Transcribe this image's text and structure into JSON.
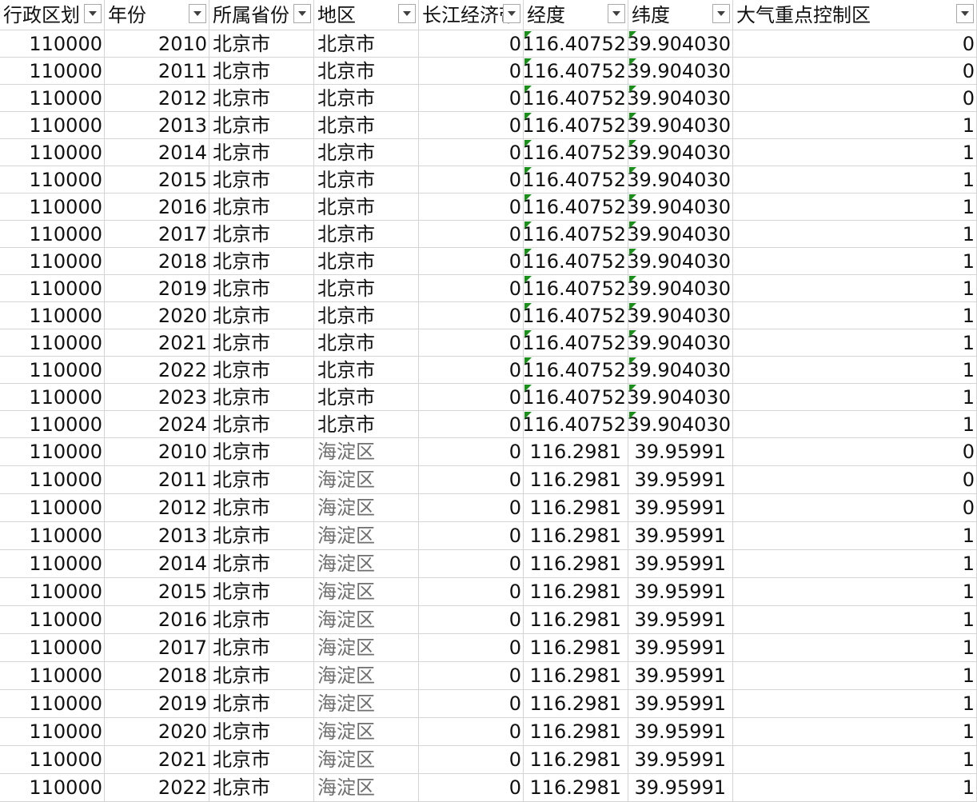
{
  "headers": [
    {
      "label": "行政区划"
    },
    {
      "label": "年份"
    },
    {
      "label": "所属省份"
    },
    {
      "label": "地区"
    },
    {
      "label": "长江经济带"
    },
    {
      "label": "经度"
    },
    {
      "label": "纬度"
    },
    {
      "label": "大气重点控制区"
    }
  ],
  "rows": [
    {
      "code": "110000",
      "year": "2010",
      "province": "北京市",
      "district": "北京市",
      "yangtze": "0",
      "lng": "116.40752",
      "lat": "39.904030",
      "air": "0"
    },
    {
      "code": "110000",
      "year": "2011",
      "province": "北京市",
      "district": "北京市",
      "yangtze": "0",
      "lng": "116.40752",
      "lat": "39.904030",
      "air": "0"
    },
    {
      "code": "110000",
      "year": "2012",
      "province": "北京市",
      "district": "北京市",
      "yangtze": "0",
      "lng": "116.40752",
      "lat": "39.904030",
      "air": "0"
    },
    {
      "code": "110000",
      "year": "2013",
      "province": "北京市",
      "district": "北京市",
      "yangtze": "0",
      "lng": "116.40752",
      "lat": "39.904030",
      "air": "1"
    },
    {
      "code": "110000",
      "year": "2014",
      "province": "北京市",
      "district": "北京市",
      "yangtze": "0",
      "lng": "116.40752",
      "lat": "39.904030",
      "air": "1"
    },
    {
      "code": "110000",
      "year": "2015",
      "province": "北京市",
      "district": "北京市",
      "yangtze": "0",
      "lng": "116.40752",
      "lat": "39.904030",
      "air": "1"
    },
    {
      "code": "110000",
      "year": "2016",
      "province": "北京市",
      "district": "北京市",
      "yangtze": "0",
      "lng": "116.40752",
      "lat": "39.904030",
      "air": "1"
    },
    {
      "code": "110000",
      "year": "2017",
      "province": "北京市",
      "district": "北京市",
      "yangtze": "0",
      "lng": "116.40752",
      "lat": "39.904030",
      "air": "1"
    },
    {
      "code": "110000",
      "year": "2018",
      "province": "北京市",
      "district": "北京市",
      "yangtze": "0",
      "lng": "116.40752",
      "lat": "39.904030",
      "air": "1"
    },
    {
      "code": "110000",
      "year": "2019",
      "province": "北京市",
      "district": "北京市",
      "yangtze": "0",
      "lng": "116.40752",
      "lat": "39.904030",
      "air": "1"
    },
    {
      "code": "110000",
      "year": "2020",
      "province": "北京市",
      "district": "北京市",
      "yangtze": "0",
      "lng": "116.40752",
      "lat": "39.904030",
      "air": "1"
    },
    {
      "code": "110000",
      "year": "2021",
      "province": "北京市",
      "district": "北京市",
      "yangtze": "0",
      "lng": "116.40752",
      "lat": "39.904030",
      "air": "1"
    },
    {
      "code": "110000",
      "year": "2022",
      "province": "北京市",
      "district": "北京市",
      "yangtze": "0",
      "lng": "116.40752",
      "lat": "39.904030",
      "air": "1"
    },
    {
      "code": "110000",
      "year": "2023",
      "province": "北京市",
      "district": "北京市",
      "yangtze": "0",
      "lng": "116.40752",
      "lat": "39.904030",
      "air": "1"
    },
    {
      "code": "110000",
      "year": "2024",
      "province": "北京市",
      "district": "北京市",
      "yangtze": "0",
      "lng": "116.40752",
      "lat": "39.904030",
      "air": "1"
    },
    {
      "code": "110000",
      "year": "2010",
      "province": "北京市",
      "district": "海淀区",
      "yangtze": "0",
      "lng": "116.2981",
      "lat": "39.95991",
      "air": "0"
    },
    {
      "code": "110000",
      "year": "2011",
      "province": "北京市",
      "district": "海淀区",
      "yangtze": "0",
      "lng": "116.2981",
      "lat": "39.95991",
      "air": "0"
    },
    {
      "code": "110000",
      "year": "2012",
      "province": "北京市",
      "district": "海淀区",
      "yangtze": "0",
      "lng": "116.2981",
      "lat": "39.95991",
      "air": "0"
    },
    {
      "code": "110000",
      "year": "2013",
      "province": "北京市",
      "district": "海淀区",
      "yangtze": "0",
      "lng": "116.2981",
      "lat": "39.95991",
      "air": "1"
    },
    {
      "code": "110000",
      "year": "2014",
      "province": "北京市",
      "district": "海淀区",
      "yangtze": "0",
      "lng": "116.2981",
      "lat": "39.95991",
      "air": "1"
    },
    {
      "code": "110000",
      "year": "2015",
      "province": "北京市",
      "district": "海淀区",
      "yangtze": "0",
      "lng": "116.2981",
      "lat": "39.95991",
      "air": "1"
    },
    {
      "code": "110000",
      "year": "2016",
      "province": "北京市",
      "district": "海淀区",
      "yangtze": "0",
      "lng": "116.2981",
      "lat": "39.95991",
      "air": "1"
    },
    {
      "code": "110000",
      "year": "2017",
      "province": "北京市",
      "district": "海淀区",
      "yangtze": "0",
      "lng": "116.2981",
      "lat": "39.95991",
      "air": "1"
    },
    {
      "code": "110000",
      "year": "2018",
      "province": "北京市",
      "district": "海淀区",
      "yangtze": "0",
      "lng": "116.2981",
      "lat": "39.95991",
      "air": "1"
    },
    {
      "code": "110000",
      "year": "2019",
      "province": "北京市",
      "district": "海淀区",
      "yangtze": "0",
      "lng": "116.2981",
      "lat": "39.95991",
      "air": "1"
    },
    {
      "code": "110000",
      "year": "2020",
      "province": "北京市",
      "district": "海淀区",
      "yangtze": "0",
      "lng": "116.2981",
      "lat": "39.95991",
      "air": "1"
    },
    {
      "code": "110000",
      "year": "2021",
      "province": "北京市",
      "district": "海淀区",
      "yangtze": "0",
      "lng": "116.2981",
      "lat": "39.95991",
      "air": "1"
    },
    {
      "code": "110000",
      "year": "2022",
      "province": "北京市",
      "district": "海淀区",
      "yangtze": "0",
      "lng": "116.2981",
      "lat": "39.95991",
      "air": "1"
    }
  ],
  "colors": {
    "gridline": "#d4d4d4",
    "error_triangle": "#1a8f1a",
    "muted_text": "#6e6e6e"
  },
  "icons": {
    "filter": "filter-dropdown-icon",
    "error": "error-indicator-icon"
  }
}
